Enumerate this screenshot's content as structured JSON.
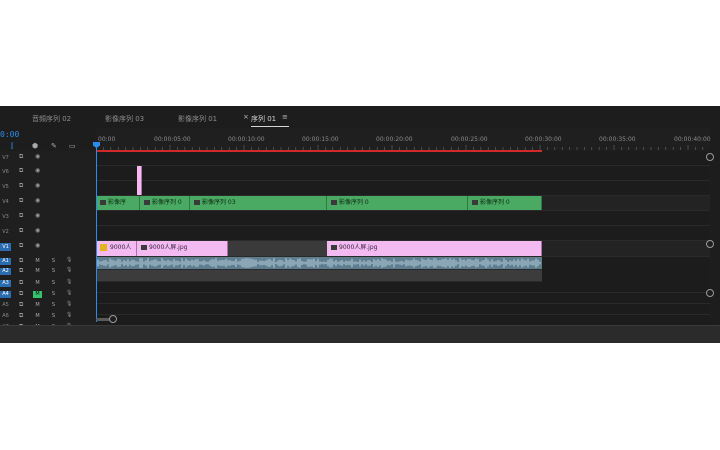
{
  "tabs": [
    {
      "label": "音頻序列 02",
      "active": false
    },
    {
      "label": "影像序列 03",
      "active": false
    },
    {
      "label": "影像序列 01",
      "active": false
    },
    {
      "label": "序列 01",
      "active": true
    }
  ],
  "tab_close": "×",
  "tab_menu": "≡",
  "timecode": "0:00",
  "ruler_labels": [
    "00:00",
    "00:00:05:00",
    "00:00:10:00",
    "00:00:15:00",
    "00:00:20:00",
    "00:00:25:00",
    "00:00:30:00",
    "00:00:35:00",
    "00:00:40:00"
  ],
  "header_icons": [
    "snap-icon",
    "marker-icon",
    "wrench-icon",
    "captions-icon"
  ],
  "video_tracks": [
    {
      "name": "V7",
      "targeted": false
    },
    {
      "name": "V6",
      "targeted": false
    },
    {
      "name": "V5",
      "targeted": false
    },
    {
      "name": "V4",
      "targeted": false
    },
    {
      "name": "V3",
      "targeted": false
    },
    {
      "name": "V2",
      "targeted": false
    },
    {
      "name": "V1",
      "targeted": true
    }
  ],
  "audio_tracks": [
    {
      "name": "A1",
      "targeted": true,
      "m": "M",
      "s": "S",
      "m_on": false
    },
    {
      "name": "A2",
      "targeted": true,
      "m": "M",
      "s": "S",
      "m_on": false
    },
    {
      "name": "A3",
      "targeted": true,
      "m": "M",
      "s": "S",
      "m_on": false
    },
    {
      "name": "A4",
      "targeted": true,
      "m": "M",
      "s": "S",
      "m_on": true
    },
    {
      "name": "A5",
      "targeted": false,
      "m": "M",
      "s": "S",
      "m_on": false
    },
    {
      "name": "A6",
      "targeted": false,
      "m": "M",
      "s": "S",
      "m_on": false
    },
    {
      "name": "A7",
      "targeted": false,
      "m": "M",
      "s": "S",
      "m_on": false
    }
  ],
  "clips": {
    "v4": [
      {
        "label": "影像序",
        "color": "green"
      },
      {
        "label": "影像序列 0",
        "color": "green"
      },
      {
        "label": "影像序列 03",
        "color": "green"
      },
      {
        "label": "影像序列 0",
        "color": "green"
      },
      {
        "label": "影像序列 0",
        "color": "green"
      }
    ],
    "v1": [
      {
        "label": "9000人",
        "color": "pink",
        "fx": true
      },
      {
        "label": "9000人屏.jpg",
        "color": "pink",
        "fx": false
      },
      {
        "label": "9000人屏.jpg",
        "color": "pink",
        "fx": false
      }
    ]
  },
  "colors": {
    "clip_green": "#4aa963",
    "clip_pink": "#f2baf0",
    "playhead": "#2d8ceb",
    "work_area": "#d12828",
    "mute_on": "#33c46c"
  }
}
